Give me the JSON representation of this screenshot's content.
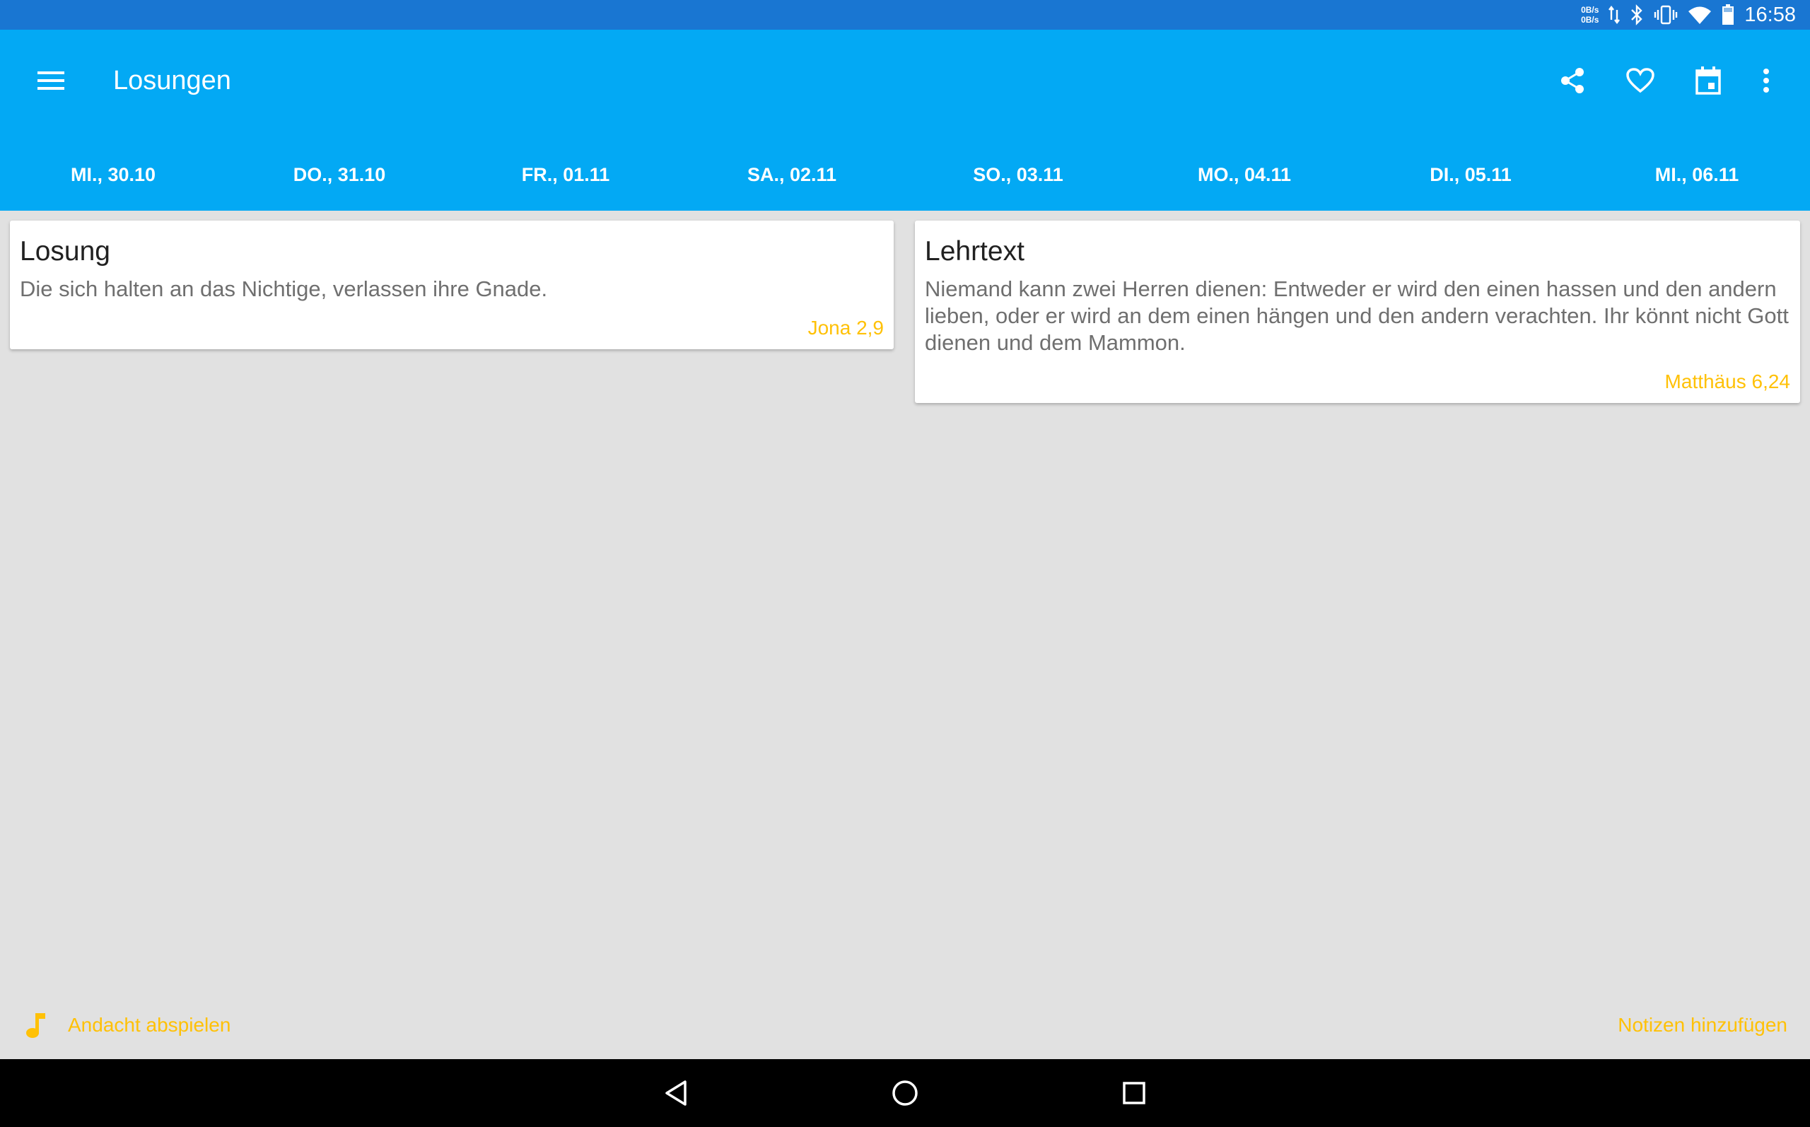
{
  "status_bar": {
    "net_up": "0B/s",
    "net_down": "0B/s",
    "icons": [
      "data-transfer-icon",
      "bluetooth-icon",
      "vibrate-icon",
      "wifi-icon",
      "battery-icon"
    ],
    "time": "16:58"
  },
  "app_bar": {
    "title": "Losungen",
    "actions": [
      "share-icon",
      "heart-icon",
      "calendar-icon",
      "more-vert-icon"
    ]
  },
  "tabs": [
    {
      "label": "MI., 30.10"
    },
    {
      "label": "DO., 31.10"
    },
    {
      "label": "FR., 01.11"
    },
    {
      "label": "SA., 02.11"
    },
    {
      "label": "SO., 03.11"
    },
    {
      "label": "MO., 04.11"
    },
    {
      "label": "DI., 05.11"
    },
    {
      "label": "MI., 06.11"
    }
  ],
  "cards": {
    "losung": {
      "title": "Losung",
      "text": "Die sich halten an das Nichtige, verlassen ihre Gnade.",
      "reference": "Jona 2,9"
    },
    "lehrtext": {
      "title": "Lehrtext",
      "text": "Niemand kann zwei Herren dienen: Entweder er wird den einen hassen und den andern lieben, oder er wird an dem einen hängen und den andern verachten. Ihr könnt nicht Gott dienen und dem Mammon.",
      "reference": "Matthäus 6,24"
    }
  },
  "bottom": {
    "play_label": "Andacht abspielen",
    "notes_label": "Notizen hinzufügen"
  },
  "colors": {
    "status_bar": "#1976d2",
    "app_bar": "#03a9f4",
    "accent": "#ffc107",
    "background": "#e1e1e1",
    "nav_bar": "#000000"
  }
}
